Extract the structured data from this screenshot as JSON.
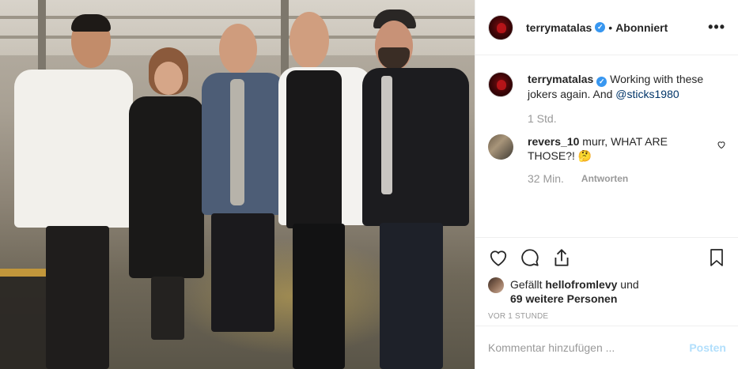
{
  "header": {
    "username": "terrymatalas",
    "separator": "•",
    "follow_status": "Abonniert",
    "more_label": "•••"
  },
  "caption": {
    "username": "terrymatalas",
    "text": "Working with these jokers again. And ",
    "mention": "@sticks1980",
    "time": "1 Std."
  },
  "comments": [
    {
      "username": "revers_10",
      "text": "murr, WHAT ARE THOSE?! 🤔",
      "time": "32 Min.",
      "reply_label": "Antworten"
    }
  ],
  "likes": {
    "prefix": "Gefällt ",
    "user": "hellofromlevy",
    "middle": " und",
    "others": "69 weitere Personen"
  },
  "timestamp": "VOR 1 STUNDE",
  "comment_box": {
    "placeholder": "Kommentar hinzufügen ...",
    "post_label": "Posten"
  },
  "colors": {
    "verified": "#3897f0",
    "link": "#003569",
    "muted": "#999999",
    "post_disabled": "#b2dffc"
  },
  "icons": {
    "verified": "verified-badge-icon",
    "more": "more-options-icon",
    "like": "heart-icon",
    "comment": "comment-bubble-icon",
    "share": "share-icon",
    "save": "bookmark-icon"
  }
}
